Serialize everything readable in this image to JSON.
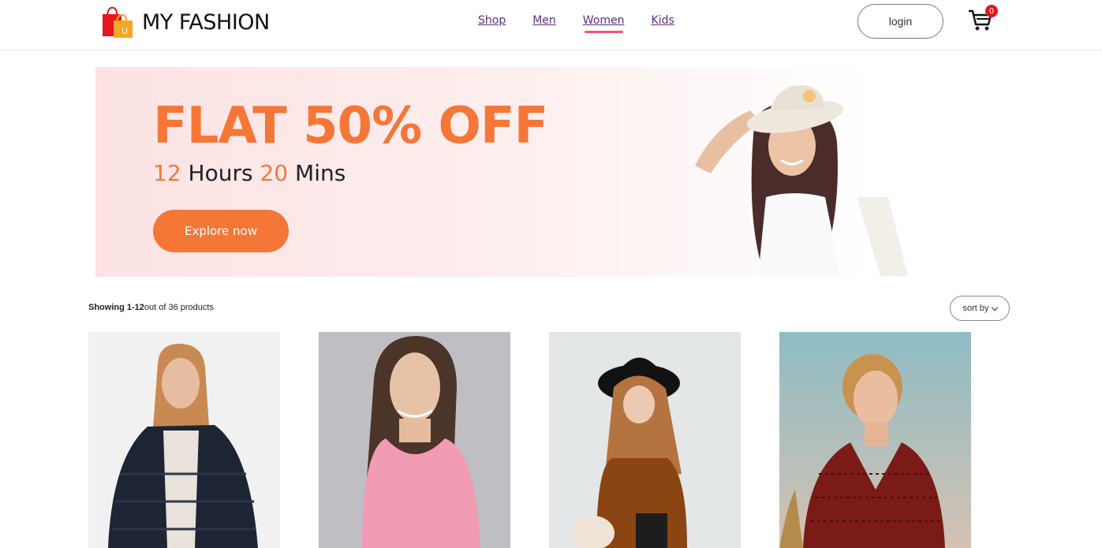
{
  "header": {
    "brand": "MY FASHION",
    "nav": [
      "Shop",
      "Men",
      "Women",
      "Kids"
    ],
    "active_nav": "Women",
    "login_label": "login",
    "cart_count": "0"
  },
  "banner": {
    "title": "FLAT 50% OFF",
    "hours_num": "12",
    "hours_label": "Hours",
    "mins_num": "20",
    "mins_label": "Mins",
    "cta": "Explore now"
  },
  "listing": {
    "showing_bold": "Showing 1-12",
    "showing_rest": "out of 36 products",
    "sort_label": "sort by"
  },
  "colors": {
    "accent": "#f47738",
    "nav_link": "#5b2e7f",
    "active_underline": "#f0566a",
    "badge": "#e8141e"
  }
}
